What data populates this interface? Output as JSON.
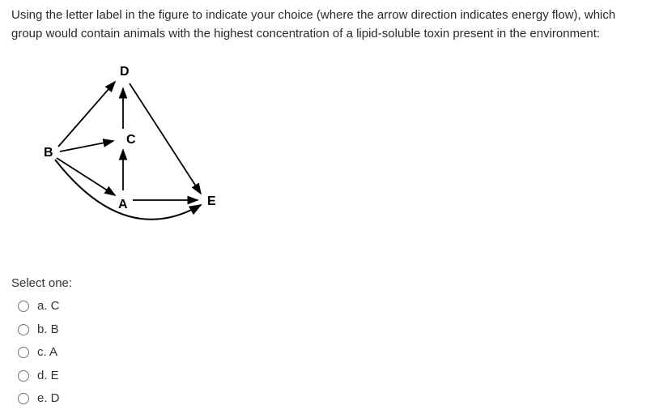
{
  "question": "Using the letter label in the figure to indicate your choice (where the arrow direction indicates energy flow), which group would contain animals with the highest concentration of a lipid-soluble toxin present in the environment:",
  "diagram": {
    "nodes": [
      "A",
      "B",
      "C",
      "D",
      "E"
    ],
    "edges": [
      {
        "from": "B",
        "to": "C"
      },
      {
        "from": "B",
        "to": "D"
      },
      {
        "from": "B",
        "to": "A"
      },
      {
        "from": "B",
        "to": "E"
      },
      {
        "from": "A",
        "to": "C"
      },
      {
        "from": "A",
        "to": "E"
      },
      {
        "from": "C",
        "to": "D"
      },
      {
        "from": "D",
        "to": "E"
      }
    ]
  },
  "select_one": "Select one:",
  "options": [
    {
      "key": "a",
      "label": "a. C"
    },
    {
      "key": "b",
      "label": "b. B"
    },
    {
      "key": "c",
      "label": "c. A"
    },
    {
      "key": "d",
      "label": "d. E"
    },
    {
      "key": "e",
      "label": "e. D"
    }
  ]
}
